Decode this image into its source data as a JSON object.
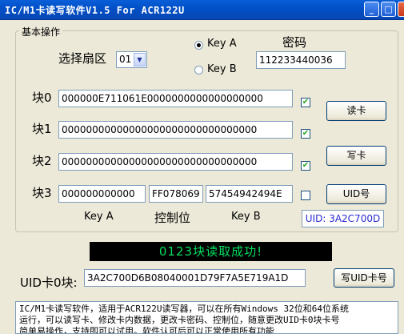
{
  "window": {
    "title": "IC/M1卡读写软件V1.5 For  ACR122U",
    "min_icon": "minimize-icon",
    "max_icon": "maximize-icon",
    "close_icon": "close-icon"
  },
  "group": {
    "legend": "基本操作",
    "sector_label": "选择扇区",
    "sector_value": "01",
    "key_a_label": "Key A",
    "key_b_label": "Key B",
    "key_selected": "Key A",
    "password_label": "密码",
    "password_value": "112233440036"
  },
  "blocks": [
    {
      "label": "块0",
      "value": "000000E711061E0000000000000000000",
      "checked": true
    },
    {
      "label": "块1",
      "value": "00000000000000000000000000000000",
      "checked": true
    },
    {
      "label": "块2",
      "value": "00000000000000000000000000000000",
      "checked": true
    }
  ],
  "block3": {
    "label": "块3",
    "key_a": "000000000000",
    "control": "FF078069",
    "key_b": "57454942494E",
    "checked": false,
    "key_a_caption": "Key A",
    "control_caption": "控制位",
    "key_b_caption": "Key B"
  },
  "buttons": {
    "read": "读卡",
    "write": "写卡",
    "uid": "UID号",
    "write_uid": "写UID卡号"
  },
  "uid_display": "UID: 3A2C700D",
  "status_message": "0123块读取成功!",
  "uid_block": {
    "label": "UID卡0块:",
    "value": "3A2C700D6B08040001D79F7A5E719A1D"
  },
  "info_lines": [
    "IC/M1卡读写软件，适用于ACR122U读写器，可以在所有Windows 32位和64位系统",
    "运行，可以读写卡、修改卡内数据，更改卡密码、控制位，随意更改UID卡0块卡号",
    "简单易操作，支持即可以试用。软件认可后可以正常使用所有功能"
  ],
  "colors": {
    "titlebar": "#0050c8",
    "status_bg": "#000000",
    "status_text": "#00e060",
    "uid_text": "#2a2ad0"
  }
}
